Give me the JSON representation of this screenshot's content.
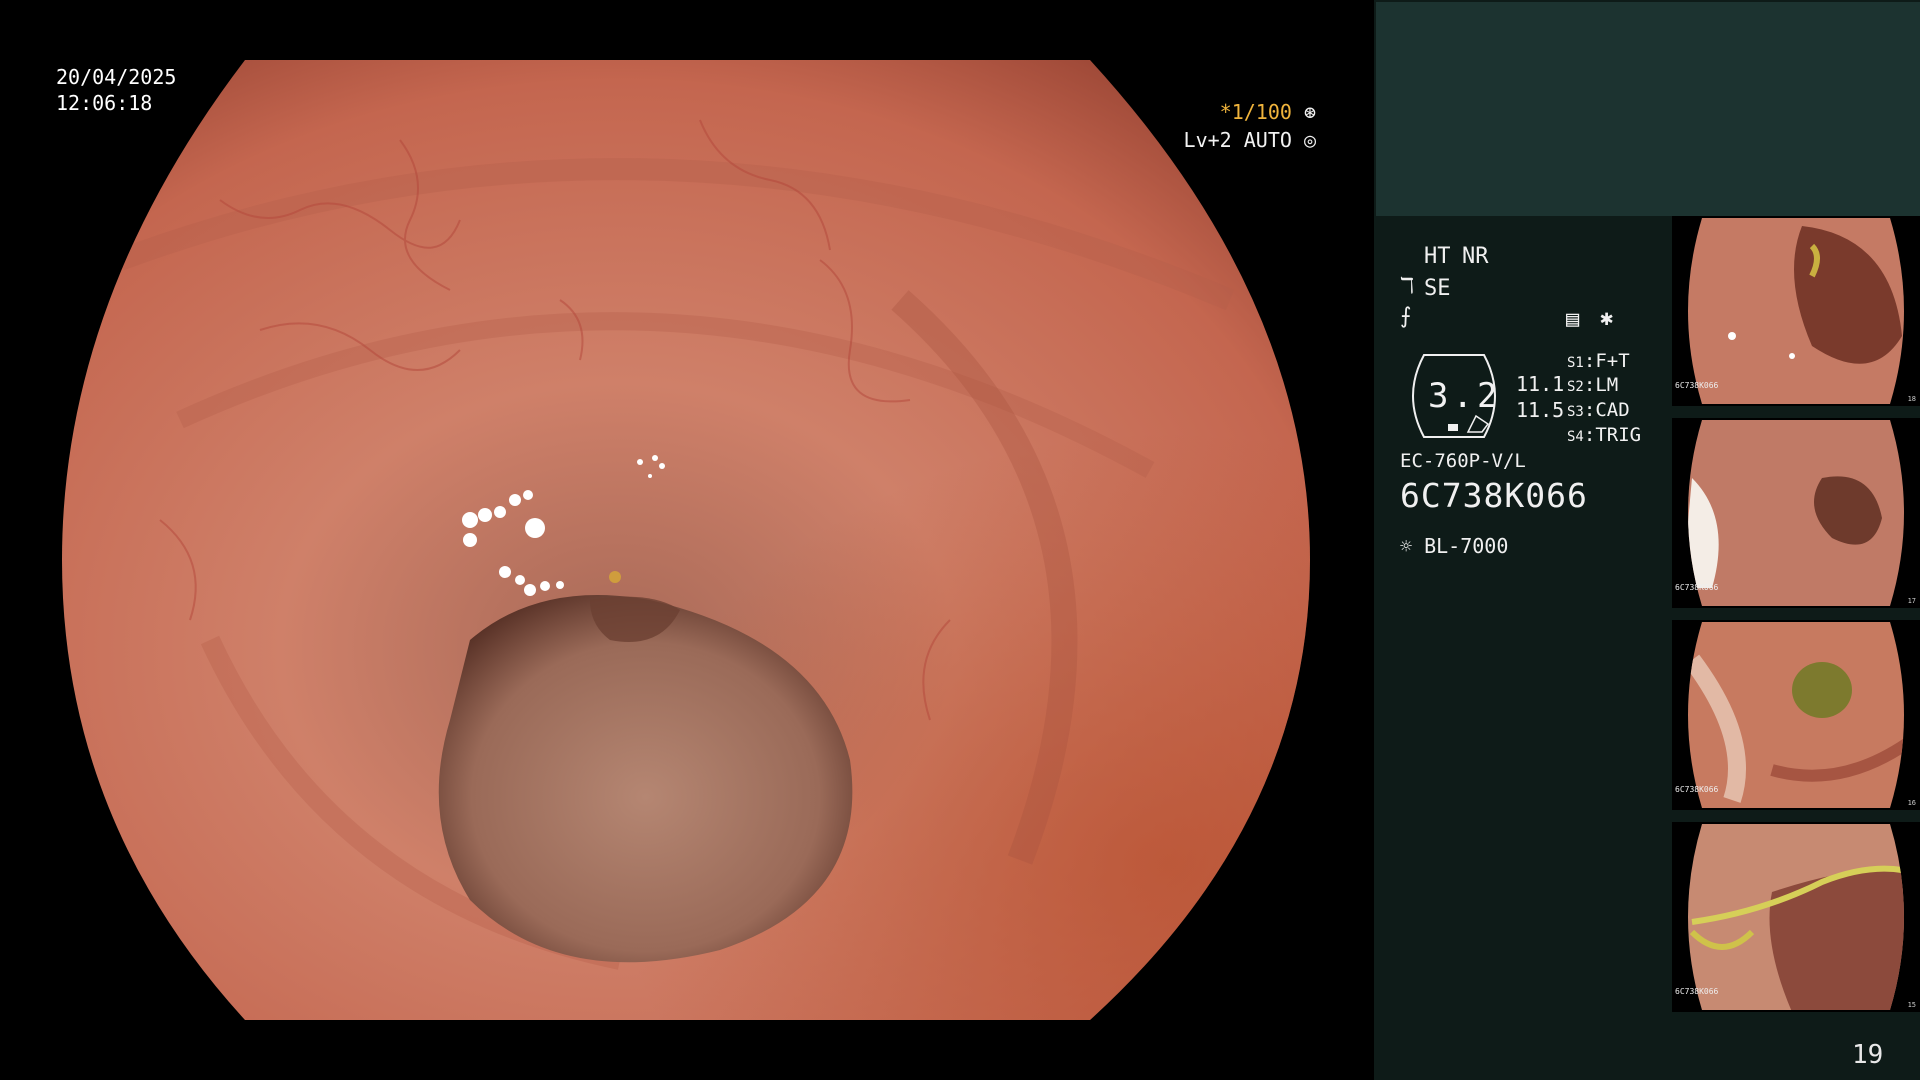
{
  "overlay": {
    "date": "20/04/2025",
    "time": "12:06:18",
    "shutter": "*1/100",
    "level": "Lv+2 AUTO"
  },
  "panel": {
    "mode_ht": "HT",
    "mode_nr": "NR",
    "mode_se": "SE",
    "zoom_value": "3.2",
    "zoom_a": "11.1",
    "zoom_b": "11.5",
    "switches": [
      {
        "key": "S1",
        "value": "F+T"
      },
      {
        "key": "S2",
        "value": "LM"
      },
      {
        "key": "S3",
        "value": "CAD"
      },
      {
        "key": "S4",
        "value": "TRIG"
      }
    ],
    "scope_model": "EC-760P-V/L",
    "scope_serial": "6C738K066",
    "light_source": "BL-7000",
    "page_number": "19"
  },
  "thumbnails": [
    {
      "serial": "6C738K066",
      "number": "18"
    },
    {
      "serial": "6C738K066",
      "number": "17"
    },
    {
      "serial": "6C738K066",
      "number": "16"
    },
    {
      "serial": "6C738K066",
      "number": "15"
    }
  ],
  "colors": {
    "mucosa": "#c9705c",
    "panel_bg": "#0e1b18",
    "panel_top": "#1c3330",
    "accent_orange": "#f0b43c"
  }
}
